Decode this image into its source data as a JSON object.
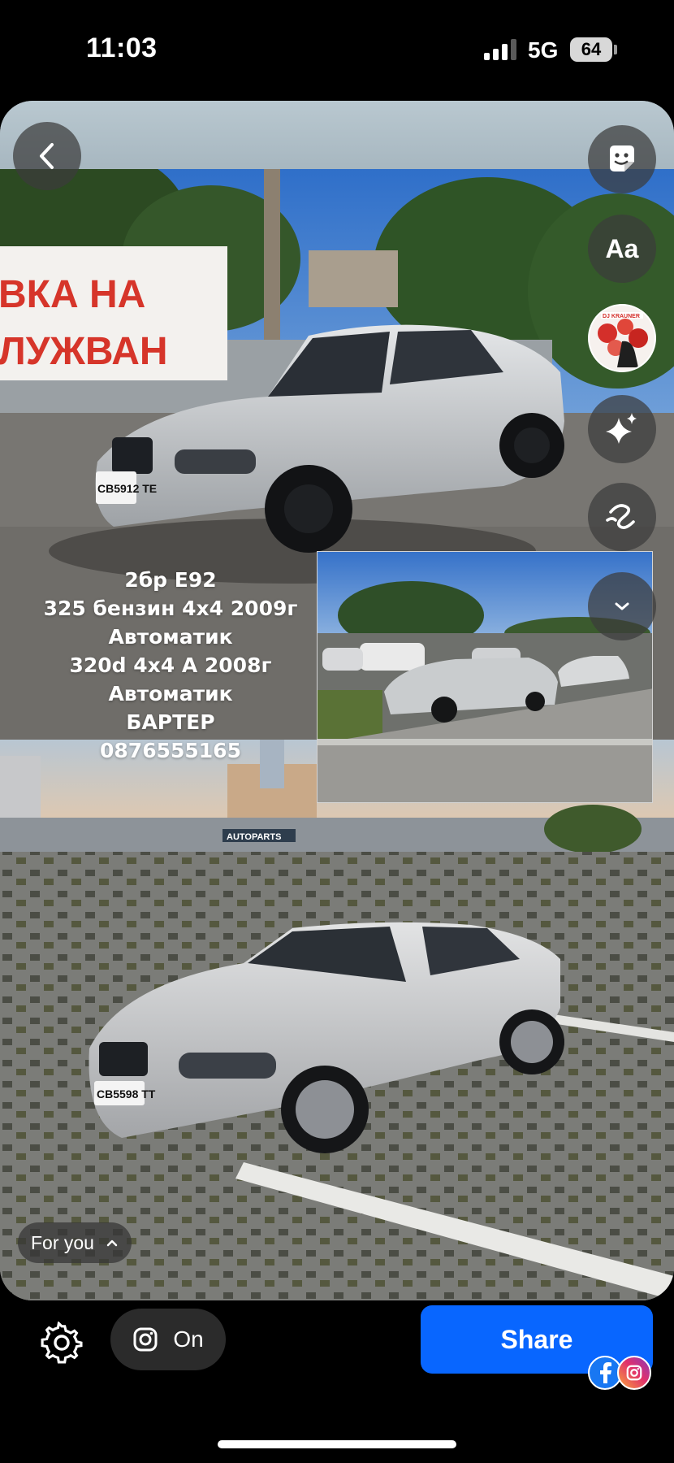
{
  "status_bar": {
    "time": "11:03",
    "network": "5G",
    "battery": "64"
  },
  "story": {
    "caption_lines": [
      "2бр Е92",
      "325 бензин 4х4 2009г",
      "Автоматик",
      "320d 4х4 А 2008г",
      "Автоматик",
      "БАРТЕР",
      "0876555165"
    ],
    "banner_text_line1": "ВКА НА",
    "banner_text_line2": "ЛУЖВАН",
    "plate_1": "CB5912 TE",
    "plate_2": "CB5598 TT",
    "shop_sign": "AUTOPARTS",
    "text_tool_label": "Aa",
    "music_sticker_label": "DJ KRAUNER",
    "for_you_label": "For you",
    "icons": {
      "back": "chevron-left-icon",
      "sticker": "sticker-icon",
      "effects": "sparkle-icon",
      "draw": "squiggle-icon",
      "more": "chevron-down-icon",
      "for_you_chevron": "chevron-up-icon"
    }
  },
  "bottom_bar": {
    "settings_icon": "gear-icon",
    "instagram_toggle_label": "On",
    "share_label": "Share",
    "share_targets": [
      "facebook-icon",
      "instagram-icon"
    ]
  },
  "colors": {
    "share_blue": "#0866ff",
    "background": "#000000",
    "overlay_button": "#3c3c3c"
  }
}
